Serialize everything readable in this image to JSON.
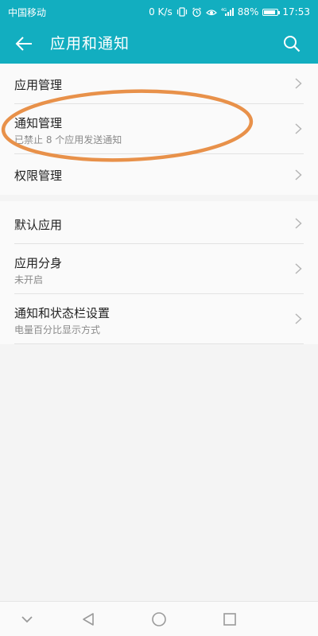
{
  "status_bar": {
    "carrier": "中国移动",
    "speed": "0 K/s",
    "signal_label": "4G",
    "battery": "88%",
    "battery_level": 88,
    "time": "17:53"
  },
  "header": {
    "title": "应用和通知",
    "back_icon": "arrow-left-icon",
    "search_icon": "search-icon"
  },
  "groups": [
    {
      "items": [
        {
          "title": "应用管理",
          "subtitle": ""
        },
        {
          "title": "通知管理",
          "subtitle": "已禁止 8 个应用发送通知"
        },
        {
          "title": "权限管理",
          "subtitle": ""
        }
      ]
    },
    {
      "items": [
        {
          "title": "默认应用",
          "subtitle": ""
        },
        {
          "title": "应用分身",
          "subtitle": "未开启"
        },
        {
          "title": "通知和状态栏设置",
          "subtitle": "电量百分比显示方式"
        }
      ]
    }
  ],
  "nav_bar": {
    "icons": [
      "chevron-down-icon",
      "back-triangle-icon",
      "home-circle-icon",
      "recents-square-icon"
    ]
  },
  "colors": {
    "header_bg": "#12aec0",
    "list_bg": "#fafafa",
    "page_bg": "#f4f4f4",
    "divider": "#e2e2e2",
    "annotation": "#e8914a"
  }
}
